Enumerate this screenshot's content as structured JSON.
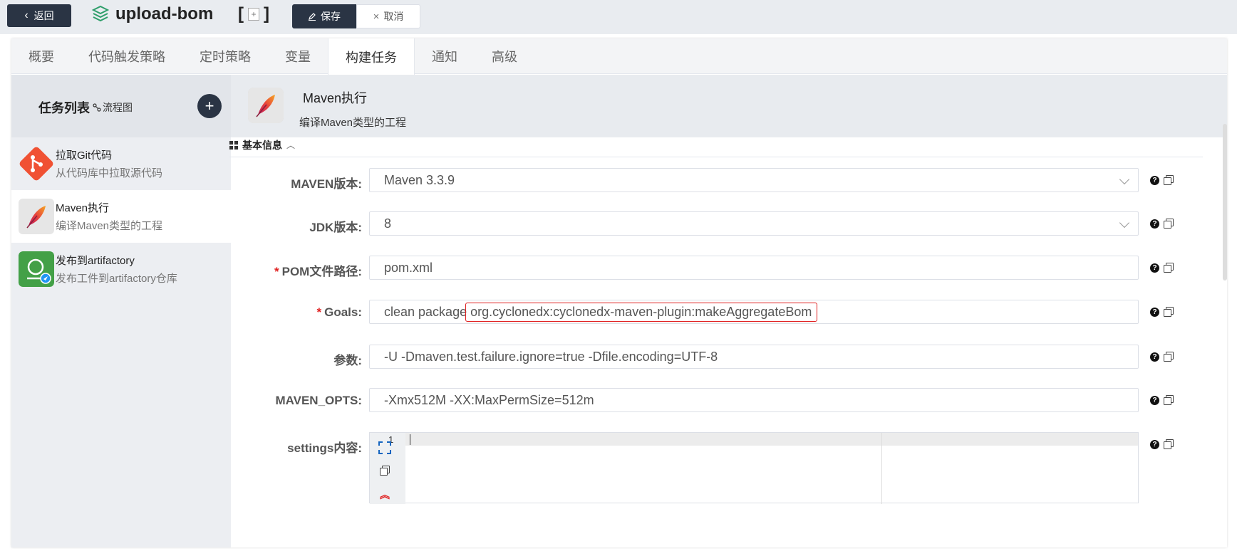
{
  "header": {
    "back_label": "返回",
    "title": "upload-bom",
    "bracket_open": "[",
    "bracket_close": "]",
    "expand_symbol": "+",
    "save_label": "保存",
    "cancel_label": "取消"
  },
  "tabs": [
    {
      "label": "概要"
    },
    {
      "label": "代码触发策略"
    },
    {
      "label": "定时策略"
    },
    {
      "label": "变量"
    },
    {
      "label": "构建任务",
      "active": true
    },
    {
      "label": "通知"
    },
    {
      "label": "高级"
    }
  ],
  "sidebar": {
    "title": "任务列表",
    "flowchart_label": "流程图",
    "add_symbol": "+",
    "items": [
      {
        "name": "拉取Git代码",
        "desc": "从代码库中拉取源代码",
        "icon": "git-icon"
      },
      {
        "name": "Maven执行",
        "desc": "编译Maven类型的工程",
        "icon": "maven-feather-icon",
        "active": true
      },
      {
        "name": "发布到artifactory",
        "desc": "发布工件到artifactory仓库",
        "icon": "artifactory-icon"
      }
    ]
  },
  "plugin": {
    "name": "Maven执行",
    "desc": "编译Maven类型的工程"
  },
  "section": {
    "title": "基本信息",
    "caret": "^"
  },
  "form": {
    "maven_version": {
      "label": "MAVEN版本:",
      "value": "Maven 3.3.9"
    },
    "jdk_version": {
      "label": "JDK版本:",
      "value": "8"
    },
    "pom_path": {
      "label": "POM文件路径:",
      "value": "pom.xml",
      "required": "*"
    },
    "goals": {
      "label": "Goals:",
      "value_prefix": "clean package",
      "value_highlight": "org.cyclonedx:cyclonedx-maven-plugin:makeAggregateBom",
      "required": "*"
    },
    "params": {
      "label": "参数:",
      "value": "-U -Dmaven.test.failure.ignore=true -Dfile.encoding=UTF-8"
    },
    "maven_opts": {
      "label": "MAVEN_OPTS:",
      "value": "-Xmx512M -XX:MaxPermSize=512m"
    },
    "settings": {
      "label": "settings内容:",
      "line_number": "1"
    }
  },
  "help_symbol": "?",
  "colors": {
    "dark": "#2a3444",
    "required": "#e02020",
    "git": "#f05133",
    "artifactory": "#43a047",
    "accent_green": "#2e9e6a"
  }
}
